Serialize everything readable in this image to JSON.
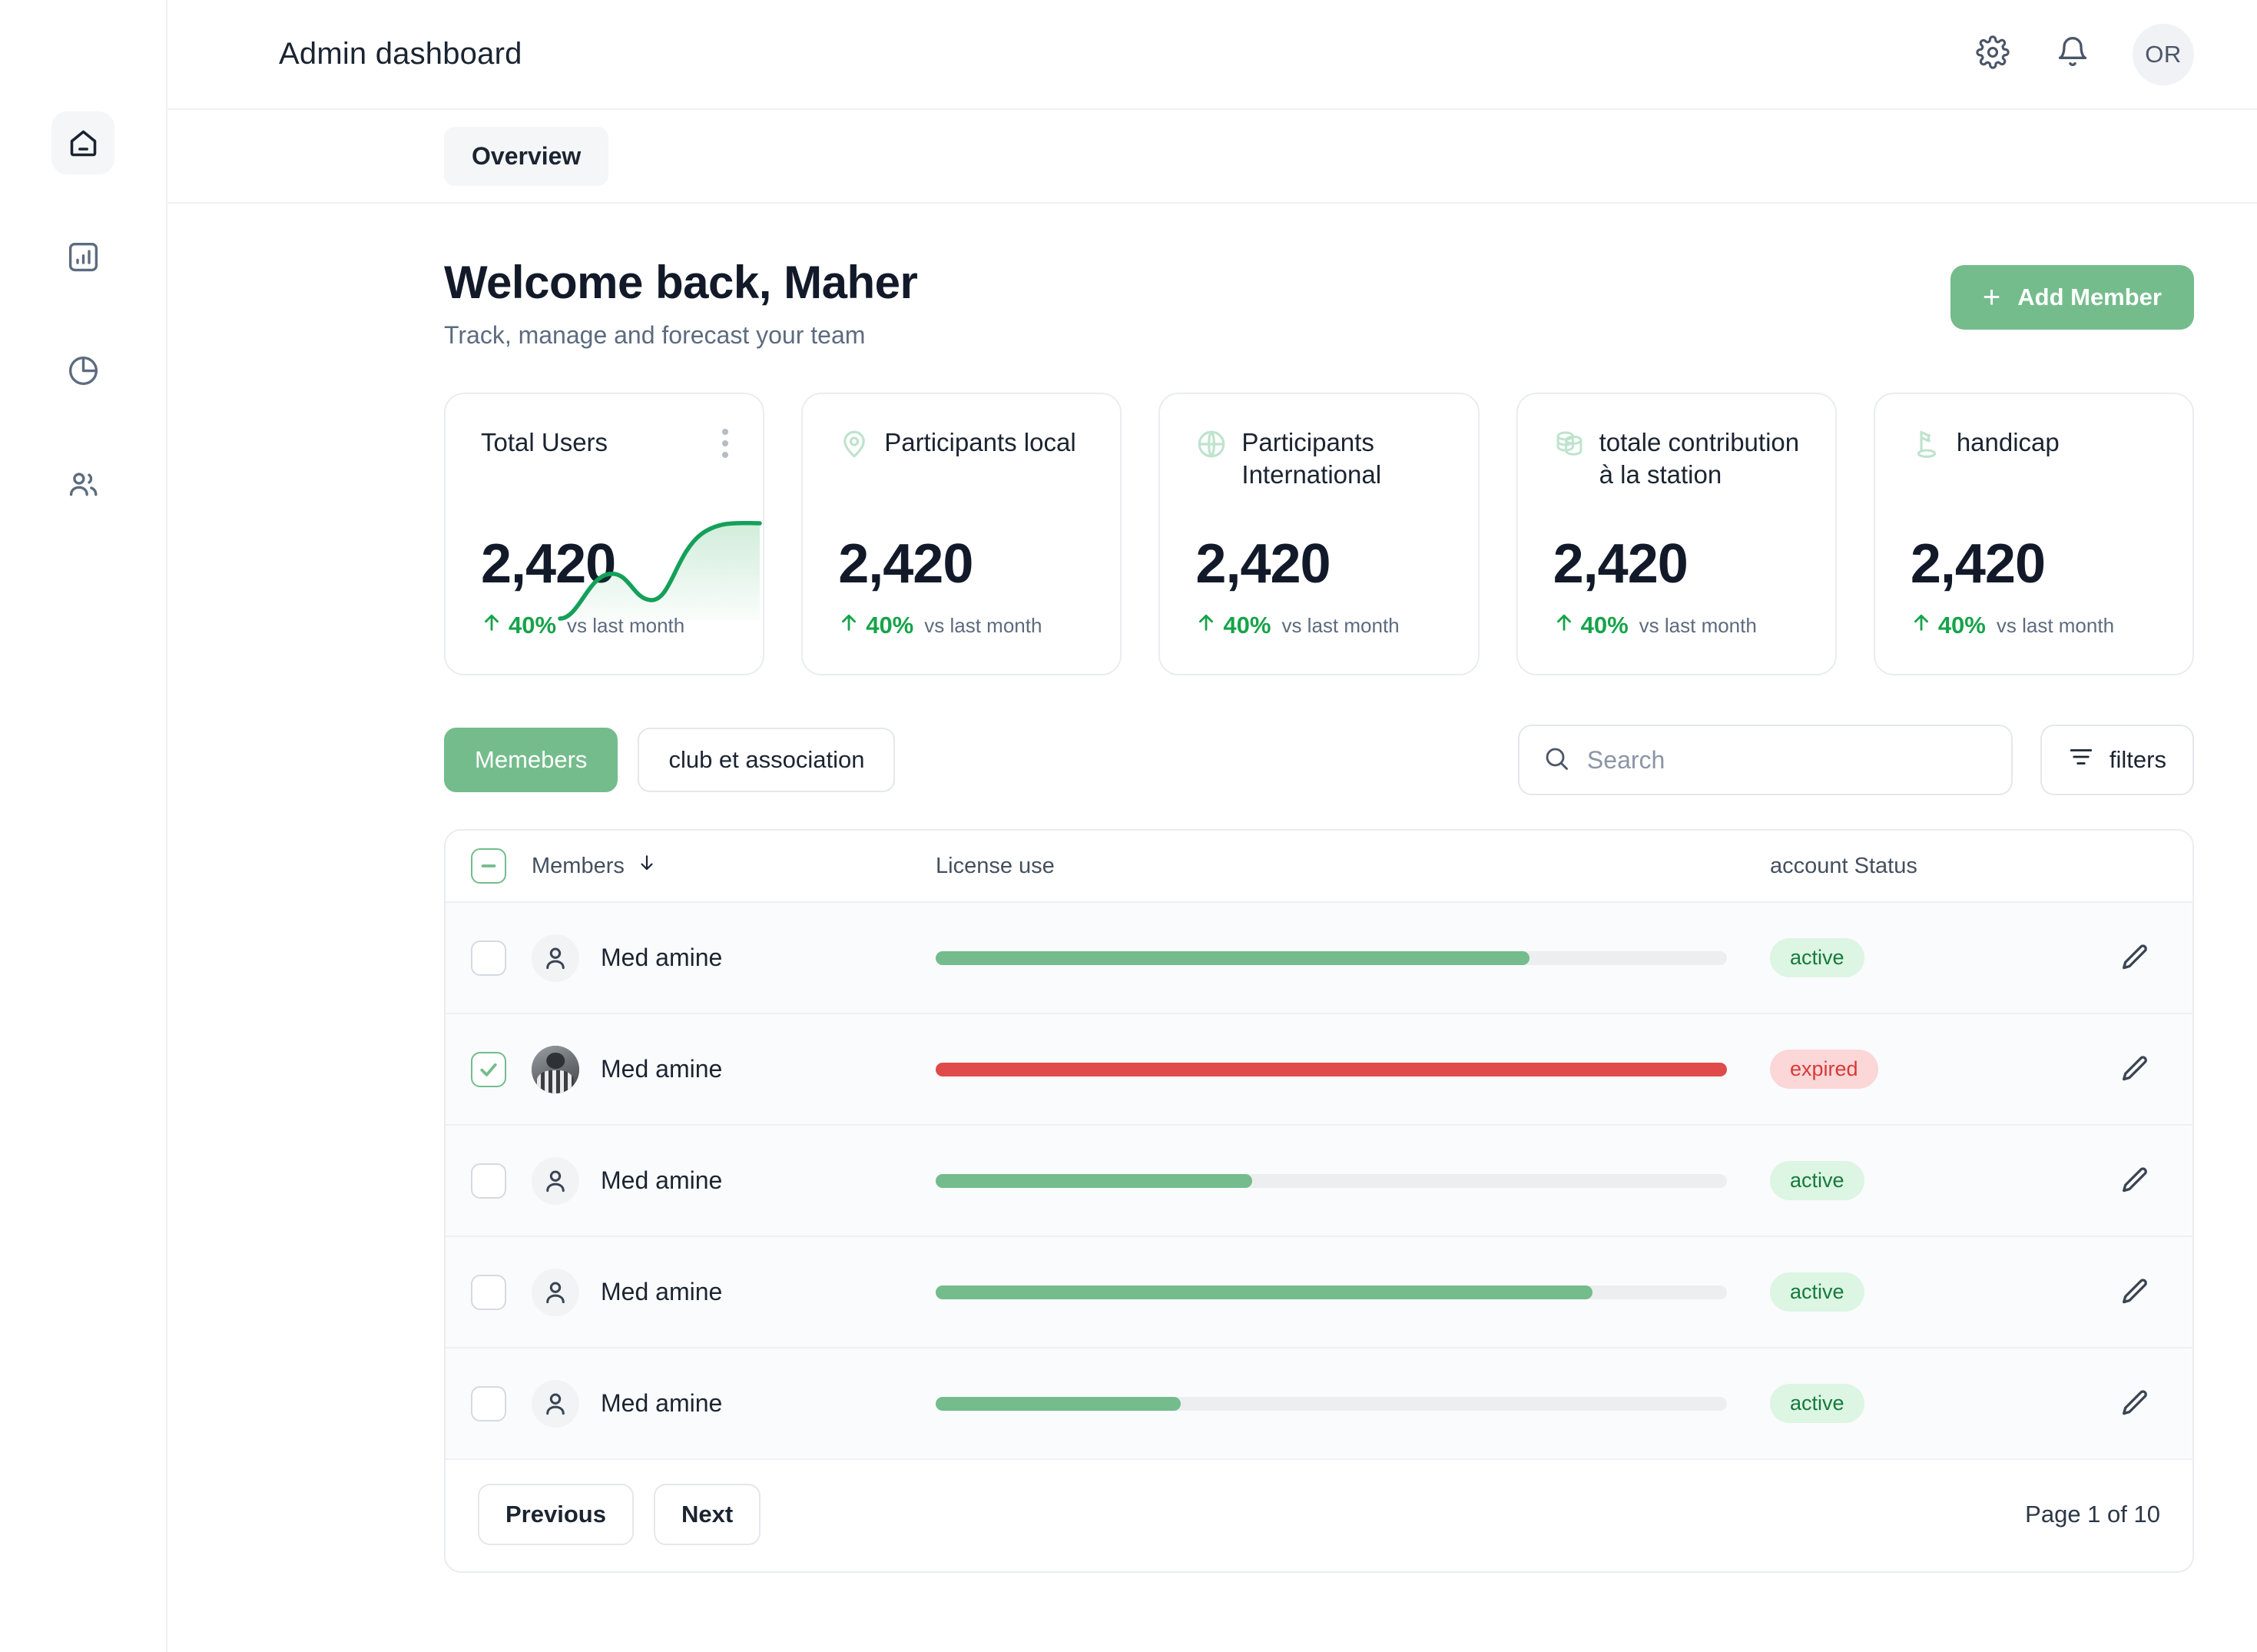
{
  "header": {
    "title": "Admin dashboard",
    "avatar_initials": "OR",
    "gear_icon": "gear-icon",
    "bell_icon": "bell-icon"
  },
  "tabs": [
    {
      "label": "Overview"
    }
  ],
  "sidebar": {
    "items": [
      {
        "icon": "home-icon",
        "active": true
      },
      {
        "icon": "bar-chart-icon",
        "active": false
      },
      {
        "icon": "pie-chart-icon",
        "active": false
      },
      {
        "icon": "users-icon",
        "active": false
      }
    ]
  },
  "welcome": {
    "title": "Welcome back, Maher",
    "subtitle": "Track, manage and forecast your team",
    "add_member_label": "Add Member",
    "add_member_plus": "+"
  },
  "stats": [
    {
      "title": "Total Users",
      "value": "2,420",
      "trend": "40%",
      "note": "vs last month",
      "icon": null,
      "menu_icon": "kebab-menu-icon",
      "has_sparkline": true
    },
    {
      "title": "Participants local",
      "value": "2,420",
      "trend": "40%",
      "note": "vs last month",
      "icon": "location-pin-icon",
      "has_sparkline": false
    },
    {
      "title": "Participants International",
      "value": "2,420",
      "trend": "40%",
      "note": "vs last month",
      "icon": "globe-icon",
      "has_sparkline": false
    },
    {
      "title": "totale contribution à la station",
      "value": "2,420",
      "trend": "40%",
      "note": "vs last month",
      "icon": "coins-icon",
      "has_sparkline": false
    },
    {
      "title": "handicap",
      "value": "2,420",
      "trend": "40%",
      "note": "vs last month",
      "icon": "golf-flag-icon",
      "has_sparkline": false
    }
  ],
  "segments": [
    {
      "label": "Memebers",
      "selected": true
    },
    {
      "label": "club et association",
      "selected": false
    }
  ],
  "search": {
    "placeholder": "Search",
    "value": "",
    "icon": "search-icon"
  },
  "filters_button": {
    "label": "filters",
    "icon": "filter-icon"
  },
  "table": {
    "columns": {
      "members": "Members",
      "sort_icon": "arrow-down-icon",
      "license": "License use",
      "status": "account Status"
    },
    "header_checkbox_state": "indeterminate",
    "rows": [
      {
        "name": "Med amine",
        "avatar": "person-icon",
        "checked": false,
        "license_pct": 75,
        "license_color": "green",
        "status": "active",
        "edit_icon": "pencil-icon"
      },
      {
        "name": "Med amine",
        "avatar": "photo",
        "checked": true,
        "license_pct": 100,
        "license_color": "red",
        "status": "expired",
        "edit_icon": "pencil-icon"
      },
      {
        "name": "Med amine",
        "avatar": "person-icon",
        "checked": false,
        "license_pct": 40,
        "license_color": "green",
        "status": "active",
        "edit_icon": "pencil-icon"
      },
      {
        "name": "Med amine",
        "avatar": "person-icon",
        "checked": false,
        "license_pct": 83,
        "license_color": "green",
        "status": "active",
        "edit_icon": "pencil-icon"
      },
      {
        "name": "Med amine",
        "avatar": "person-icon",
        "checked": false,
        "license_pct": 31,
        "license_color": "green",
        "status": "active",
        "edit_icon": "pencil-icon"
      }
    ],
    "pagination": {
      "previous_label": "Previous",
      "next_label": "Next",
      "page_label": "Page 1 of 10"
    }
  },
  "colors": {
    "accent_green": "#74bc8c",
    "trend_green": "#16a34a",
    "danger_red": "#e04a4a",
    "status_active_bg": "#ddf5e3",
    "status_active_text": "#167a3c",
    "status_expired_bg": "#fbd7d7",
    "status_expired_text": "#d93939"
  }
}
